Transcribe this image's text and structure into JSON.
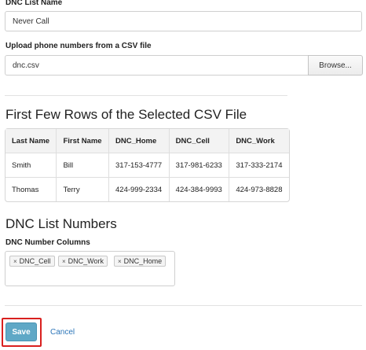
{
  "list_name": {
    "label": "DNC List Name",
    "value": "Never Call"
  },
  "upload": {
    "label": "Upload phone numbers from a CSV file",
    "file_value": "dnc.csv",
    "browse_label": "Browse..."
  },
  "preview": {
    "heading": "First Few Rows of the Selected CSV File",
    "columns": [
      "Last Name",
      "First Name",
      "DNC_Home",
      "DNC_Cell",
      "DNC_Work"
    ],
    "rows": [
      [
        "Smith",
        "Bill",
        "317-153-4777",
        "317-981-6233",
        "317-333-2174"
      ],
      [
        "Thomas",
        "Terry",
        "424-999-2334",
        "424-384-9993",
        "424-973-8828"
      ]
    ]
  },
  "numbers": {
    "heading": "DNC List Numbers",
    "columns_label": "DNC Number Columns",
    "tag_remove_glyph": "×",
    "tags": [
      "DNC_Cell",
      "DNC_Work",
      "DNC_Home"
    ]
  },
  "actions": {
    "save_label": "Save",
    "cancel_label": "Cancel"
  },
  "colors": {
    "save_bg": "#5fa8c6",
    "highlight": "#d9201f",
    "link": "#2a74b8"
  }
}
